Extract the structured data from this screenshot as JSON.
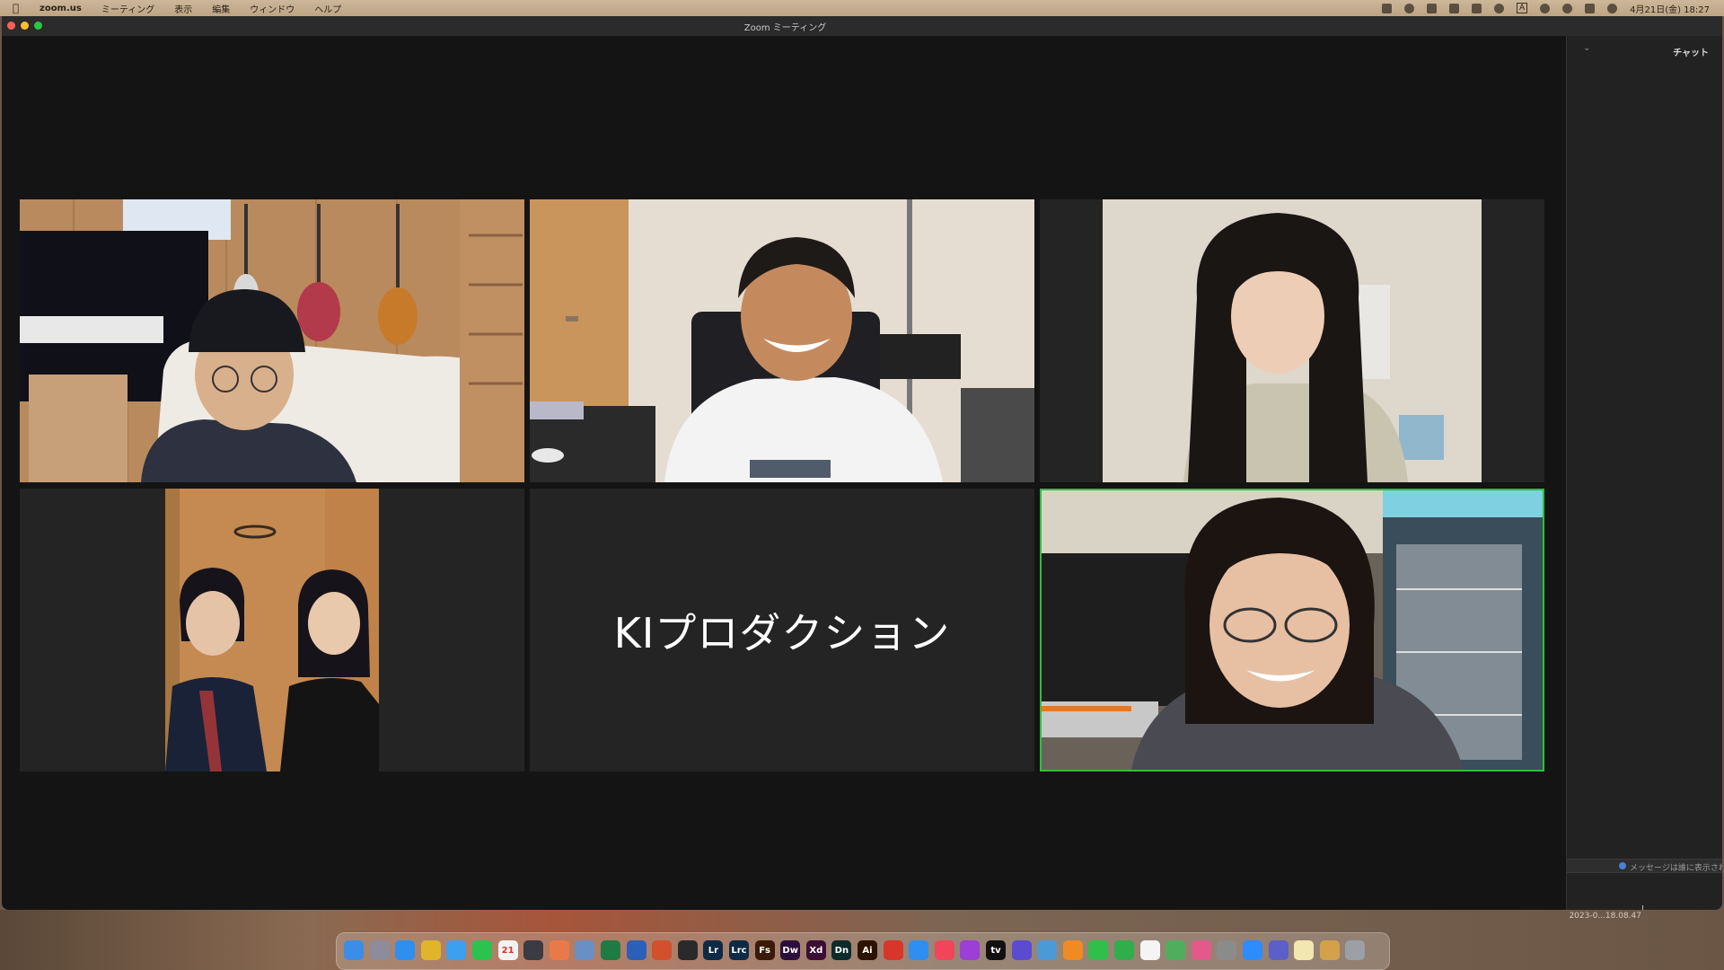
{
  "menubar": {
    "app": "zoom.us",
    "menus": [
      "ミーティング",
      "表示",
      "編集",
      "ウィンドウ",
      "ヘルプ"
    ],
    "clock": "4月21日(金) 18:27",
    "input_indicator": "A"
  },
  "window": {
    "title": "Zoom ミーティング"
  },
  "gallery": {
    "name_tile_text": "KIプロダクション",
    "active_speaker_color": "#2fbf3a"
  },
  "chat": {
    "collapse_icon": "chevron-down-icon",
    "title": "チャット",
    "notice": "メッセージは誰に表示され"
  },
  "desktop": {
    "screenshot_label": "2023-0...18.08.47"
  },
  "dock": {
    "items": [
      {
        "name": "finder",
        "label": "",
        "color": "#3b8de8"
      },
      {
        "name": "launchpad",
        "label": "",
        "color": "#8c8c9a"
      },
      {
        "name": "safari",
        "label": "",
        "color": "#2f8ff0"
      },
      {
        "name": "chrome",
        "label": "",
        "color": "#e0b52a"
      },
      {
        "name": "mail",
        "label": "",
        "color": "#3aa0ef"
      },
      {
        "name": "line",
        "label": "",
        "color": "#2bc24d"
      },
      {
        "name": "calendar",
        "label": "21",
        "color": "#f2f2f2"
      },
      {
        "name": "mission-control",
        "label": "",
        "color": "#3b3b44"
      },
      {
        "name": "photos",
        "label": "",
        "color": "#e87a4a"
      },
      {
        "name": "preview",
        "label": "",
        "color": "#6a8fc4"
      },
      {
        "name": "excel",
        "label": "",
        "color": "#1f7a44"
      },
      {
        "name": "word",
        "label": "",
        "color": "#2b5fb8"
      },
      {
        "name": "powerpoint",
        "label": "",
        "color": "#d2512d"
      },
      {
        "name": "quicktime",
        "label": "",
        "color": "#2a2a2a"
      },
      {
        "name": "lightroom",
        "label": "Lr",
        "color": "#0e2a44"
      },
      {
        "name": "lightroom-classic",
        "label": "Lrc",
        "color": "#0e2a44"
      },
      {
        "name": "fresco",
        "label": "Fs",
        "color": "#3b1a0a"
      },
      {
        "name": "dreamweaver",
        "label": "Dw",
        "color": "#2b0f3a"
      },
      {
        "name": "xd",
        "label": "Xd",
        "color": "#3a0f33"
      },
      {
        "name": "dimension",
        "label": "Dn",
        "color": "#0c2b2a"
      },
      {
        "name": "illustrator",
        "label": "Ai",
        "color": "#2b1300"
      },
      {
        "name": "acrobat",
        "label": "",
        "color": "#d8362a"
      },
      {
        "name": "app-store",
        "label": "",
        "color": "#2f8ff0"
      },
      {
        "name": "music",
        "label": "",
        "color": "#f2455a"
      },
      {
        "name": "podcasts",
        "label": "",
        "color": "#9b3fd6"
      },
      {
        "name": "tv",
        "label": "tv",
        "color": "#111111"
      },
      {
        "name": "imovie",
        "label": "",
        "color": "#5b4bd0"
      },
      {
        "name": "find-my",
        "label": "",
        "color": "#4b9ad8"
      },
      {
        "name": "books",
        "label": "",
        "color": "#f08a22"
      },
      {
        "name": "facetime",
        "label": "",
        "color": "#2fbf4a"
      },
      {
        "name": "numbers",
        "label": "",
        "color": "#2fae4b"
      },
      {
        "name": "reminders",
        "label": "",
        "color": "#f4f4f4"
      },
      {
        "name": "maps",
        "label": "",
        "color": "#4fae5e"
      },
      {
        "name": "photo-booth",
        "label": "",
        "color": "#e35a8a"
      },
      {
        "name": "system-settings",
        "label": "",
        "color": "#8b8b8b"
      },
      {
        "name": "zoom",
        "label": "",
        "color": "#2d8cff"
      },
      {
        "name": "teams",
        "label": "",
        "color": "#5b5fc7"
      },
      {
        "name": "notes",
        "label": "",
        "color": "#f2e7b0"
      },
      {
        "name": "folder",
        "label": "",
        "color": "#d3a14a"
      },
      {
        "name": "trash",
        "label": "",
        "color": "#9aa0a6"
      }
    ]
  }
}
